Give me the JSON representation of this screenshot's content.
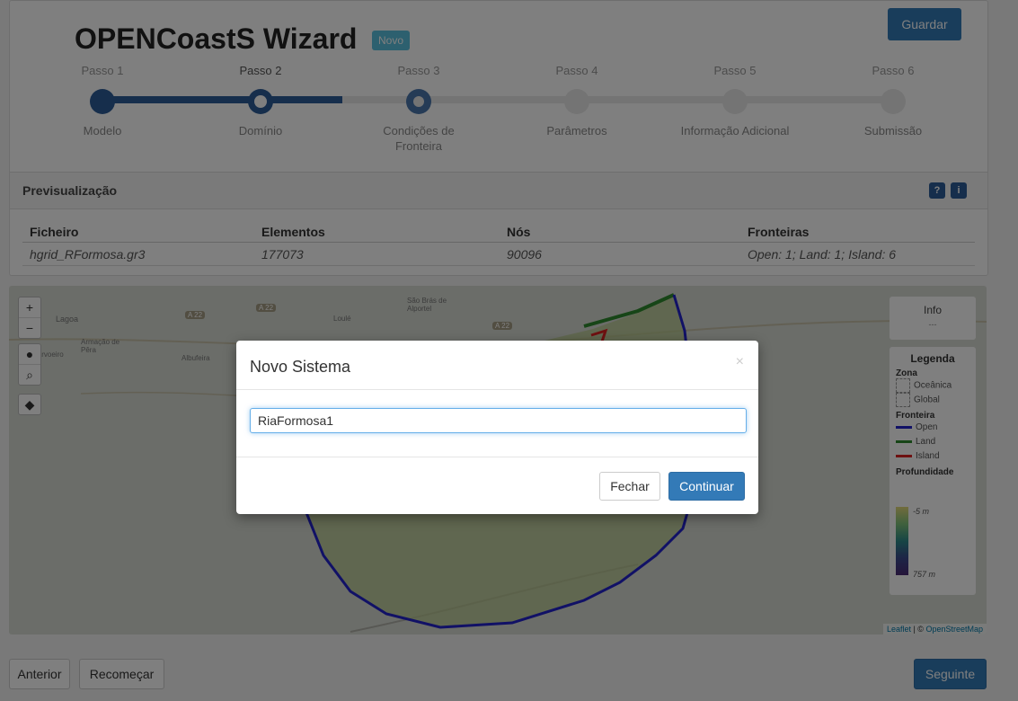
{
  "header": {
    "title": "OPENCoastS Wizard",
    "badge": "Novo",
    "save_label": "Guardar"
  },
  "steps": [
    {
      "label": "Passo 1",
      "name": "Modelo"
    },
    {
      "label": "Passo 2",
      "name": "Domínio"
    },
    {
      "label": "Passo 3",
      "name": "Condições de Fronteira"
    },
    {
      "label": "Passo 4",
      "name": "Parâmetros"
    },
    {
      "label": "Passo 5",
      "name": "Informação Adicional"
    },
    {
      "label": "Passo 6",
      "name": "Submissão"
    }
  ],
  "preview": {
    "title": "Previsualização",
    "help_icon": "question-icon",
    "info_icon": "info-icon",
    "columns": [
      "Ficheiro",
      "Elementos",
      "Nós",
      "Fronteiras"
    ],
    "row": [
      "hgrid_RFormosa.gr3",
      "177073",
      "90096",
      "Open: 1; Land: 1; Island: 6"
    ]
  },
  "map": {
    "zoom_in": "+",
    "zoom_out": "−",
    "info_title": "Info",
    "info_value": "---",
    "legend_title": "Legenda",
    "zone_title": "Zona",
    "zones": [
      "Oceânica",
      "Global"
    ],
    "boundary_title": "Fronteira",
    "boundaries": [
      {
        "name": "Open",
        "color": "#2222cc"
      },
      {
        "name": "Land",
        "color": "#2e8b2e"
      },
      {
        "name": "Island",
        "color": "#dd2222"
      }
    ],
    "depth_title": "Profundidade",
    "depth_min": "-5 m",
    "depth_max": "757 m",
    "attribution_leaflet": "Leaflet",
    "attribution_osm": "OpenStreetMap",
    "place_labels": [
      "Lagoa",
      "Armação de Pêra",
      "Carvoeiro",
      "Albufeira",
      "Loulé",
      "São Brás de Alportel",
      "A 22",
      "A 22",
      "A 22"
    ]
  },
  "footer": {
    "prev_label": "Anterior",
    "restart_label": "Recomeçar",
    "next_label": "Seguinte"
  },
  "modal": {
    "title": "Novo Sistema",
    "close_symbol": "×",
    "input_value": "RiaFormosa1",
    "close_button": "Fechar",
    "continue_button": "Continuar"
  }
}
